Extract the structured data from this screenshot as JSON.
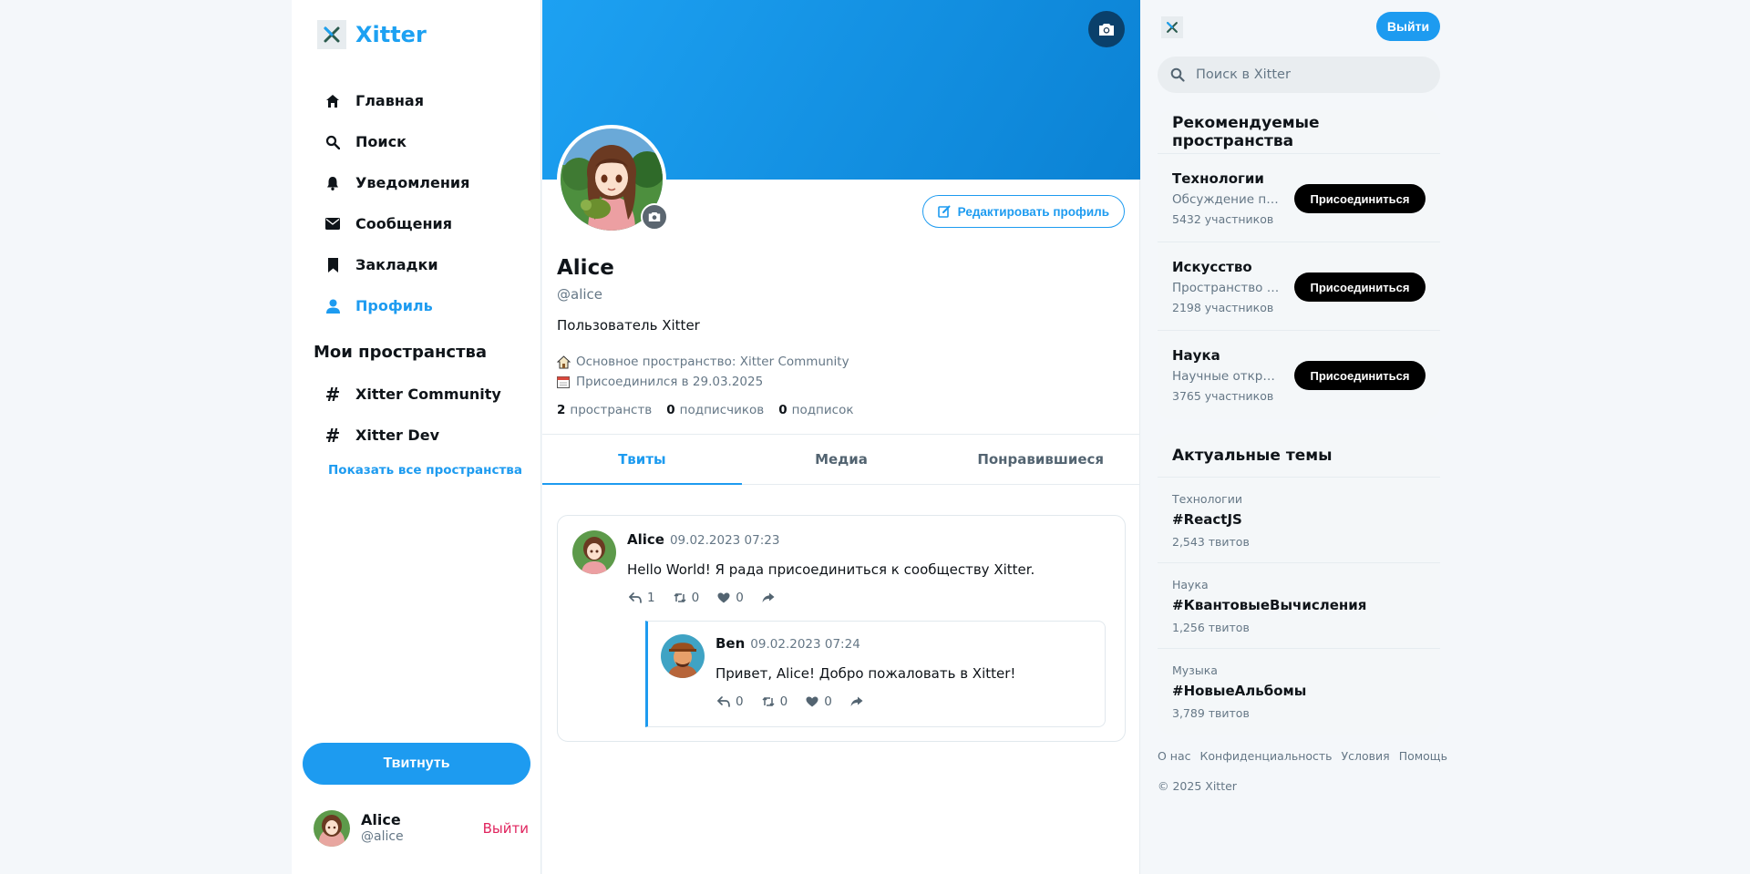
{
  "brand": {
    "name": "Xitter"
  },
  "nav": [
    {
      "label": "Главная",
      "icon": "home-icon"
    },
    {
      "label": "Поиск",
      "icon": "search-icon"
    },
    {
      "label": "Уведомления",
      "icon": "bell-icon"
    },
    {
      "label": "Сообщения",
      "icon": "envelope-icon"
    },
    {
      "label": "Закладки",
      "icon": "bookmark-icon"
    },
    {
      "label": "Профиль",
      "icon": "user-icon",
      "active": true
    }
  ],
  "spaces": {
    "title": "Мои пространства",
    "items": [
      "Xitter Community",
      "Xitter Dev"
    ],
    "show_all": "Показать все пространства"
  },
  "tweet_button": "Твитнуть",
  "current_user": {
    "name": "Alice",
    "handle": "@alice",
    "logout": "Выйти"
  },
  "profile": {
    "edit_label": "Редактировать профиль",
    "name": "Alice",
    "handle": "@alice",
    "bio": "Пользователь Xitter",
    "main_space": "Основное пространство: Xitter Community",
    "joined": "Присоединился в 29.03.2025",
    "stats": [
      {
        "value": "2",
        "label": "пространств"
      },
      {
        "value": "0",
        "label": "подписчиков"
      },
      {
        "value": "0",
        "label": "подписок"
      }
    ]
  },
  "tabs": [
    {
      "label": "Твиты",
      "active": true
    },
    {
      "label": "Медиа"
    },
    {
      "label": "Понравившиеся"
    }
  ],
  "tweet": {
    "author": "Alice",
    "time": "09.02.2023 07:23",
    "text": "Hello World! Я рада присоединиться к сообществу Xitter.",
    "replies": "1",
    "retweets": "0",
    "likes": "0",
    "reply": {
      "author": "Ben",
      "time": "09.02.2023 07:24",
      "text": "Привет, Alice! Добро пожаловать в Xitter!",
      "replies": "0",
      "retweets": "0",
      "likes": "0"
    }
  },
  "right": {
    "logout": "Выйти",
    "search_placeholder": "Поиск в Xitter",
    "recommended": {
      "title": "Рекомендуемые пространства",
      "join_label": "Присоединиться",
      "items": [
        {
          "name": "Технологии",
          "desc": "Обсуждение пос…",
          "count": "5432 участников"
        },
        {
          "name": "Искусство",
          "desc": "Пространство дл…",
          "count": "2198 участников"
        },
        {
          "name": "Наука",
          "desc": "Научные открыт…",
          "count": "3765 участников"
        }
      ]
    },
    "trends": {
      "title": "Актуальные темы",
      "items": [
        {
          "category": "Технологии",
          "tag": "#ReactJS",
          "count": "2,543 твитов"
        },
        {
          "category": "Наука",
          "tag": "#КвантовыеВычисления",
          "count": "1,256 твитов"
        },
        {
          "category": "Музыка",
          "tag": "#НовыеАльбомы",
          "count": "3,789 твитов"
        }
      ]
    },
    "footer": [
      "О нас",
      "Конфиденциальность",
      "Условия",
      "Помощь"
    ],
    "copyright": "© 2025 Xitter"
  },
  "colors": {
    "accent": "#1d9bf0",
    "logout_red": "#e0245e",
    "banner": "#1da1f2"
  }
}
